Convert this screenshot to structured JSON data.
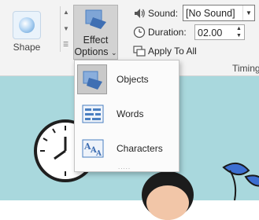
{
  "ribbon": {
    "shape_label": "Shape",
    "effect_options_label_line1": "Effect",
    "effect_options_label_line2": "Options",
    "effect_options_caret": "⌄",
    "sound_label": "Sound:",
    "sound_value": "[No Sound]",
    "duration_label": "Duration:",
    "duration_value": "02.00",
    "apply_to_all_label": "Apply To All",
    "timing_group_label": "Timing"
  },
  "effect_menu": {
    "items": [
      {
        "label": "Objects",
        "icon": "objects-icon",
        "selected": true
      },
      {
        "label": "Words",
        "icon": "words-icon",
        "selected": false
      },
      {
        "label": "Characters",
        "icon": "characters-icon",
        "selected": false
      }
    ],
    "resize_grip": "....."
  },
  "colors": {
    "accent_blue": "#4a7fc1",
    "slide_background": "#a9d8dd"
  }
}
